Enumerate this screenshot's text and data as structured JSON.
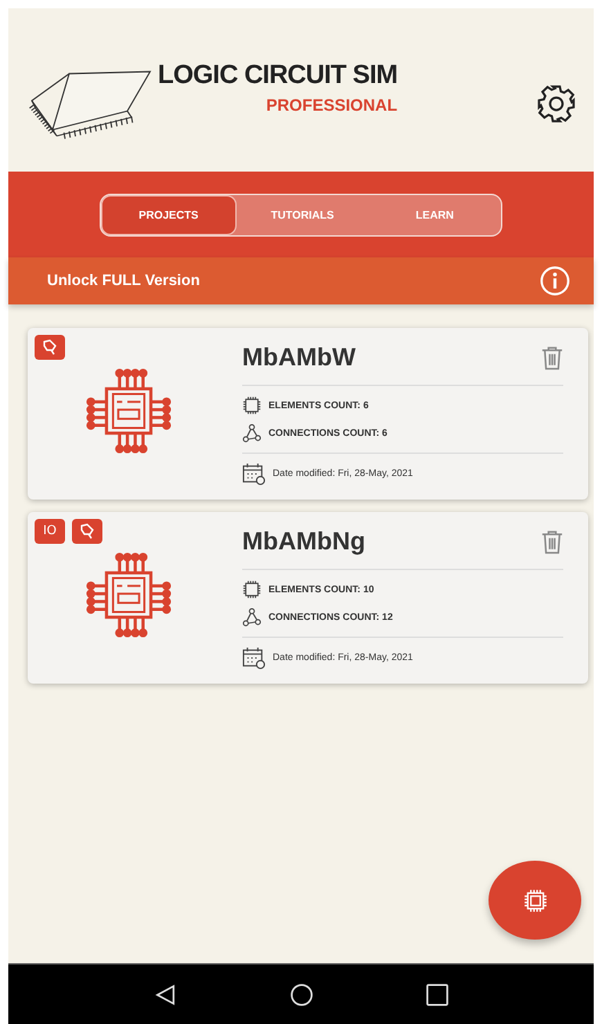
{
  "header": {
    "title": "LOGIC CIRCUIT SIM",
    "subtitle": "PROFESSIONAL"
  },
  "tabs": [
    {
      "label": "PROJECTS",
      "selected": true
    },
    {
      "label": "TUTORIALS",
      "selected": false
    },
    {
      "label": "LEARN",
      "selected": false
    }
  ],
  "unlock_bar": {
    "label": "Unlock FULL Version"
  },
  "projects": [
    {
      "name": "MbAMbW",
      "badges": [
        {
          "kind": "plug"
        }
      ],
      "elements_count": "ELEMENTS COUNT: 6",
      "connections_count": "CONNECTIONS COUNT: 6",
      "date_modified": "Date modified: Fri, 28-May, 2021"
    },
    {
      "name": "MbAMbNg",
      "badges": [
        {
          "kind": "text",
          "text": "IO"
        },
        {
          "kind": "plug"
        }
      ],
      "elements_count": "ELEMENTS COUNT: 10",
      "connections_count": "CONNECTIONS COUNT: 12",
      "date_modified": "Date modified: Fri, 28-May, 2021"
    }
  ]
}
